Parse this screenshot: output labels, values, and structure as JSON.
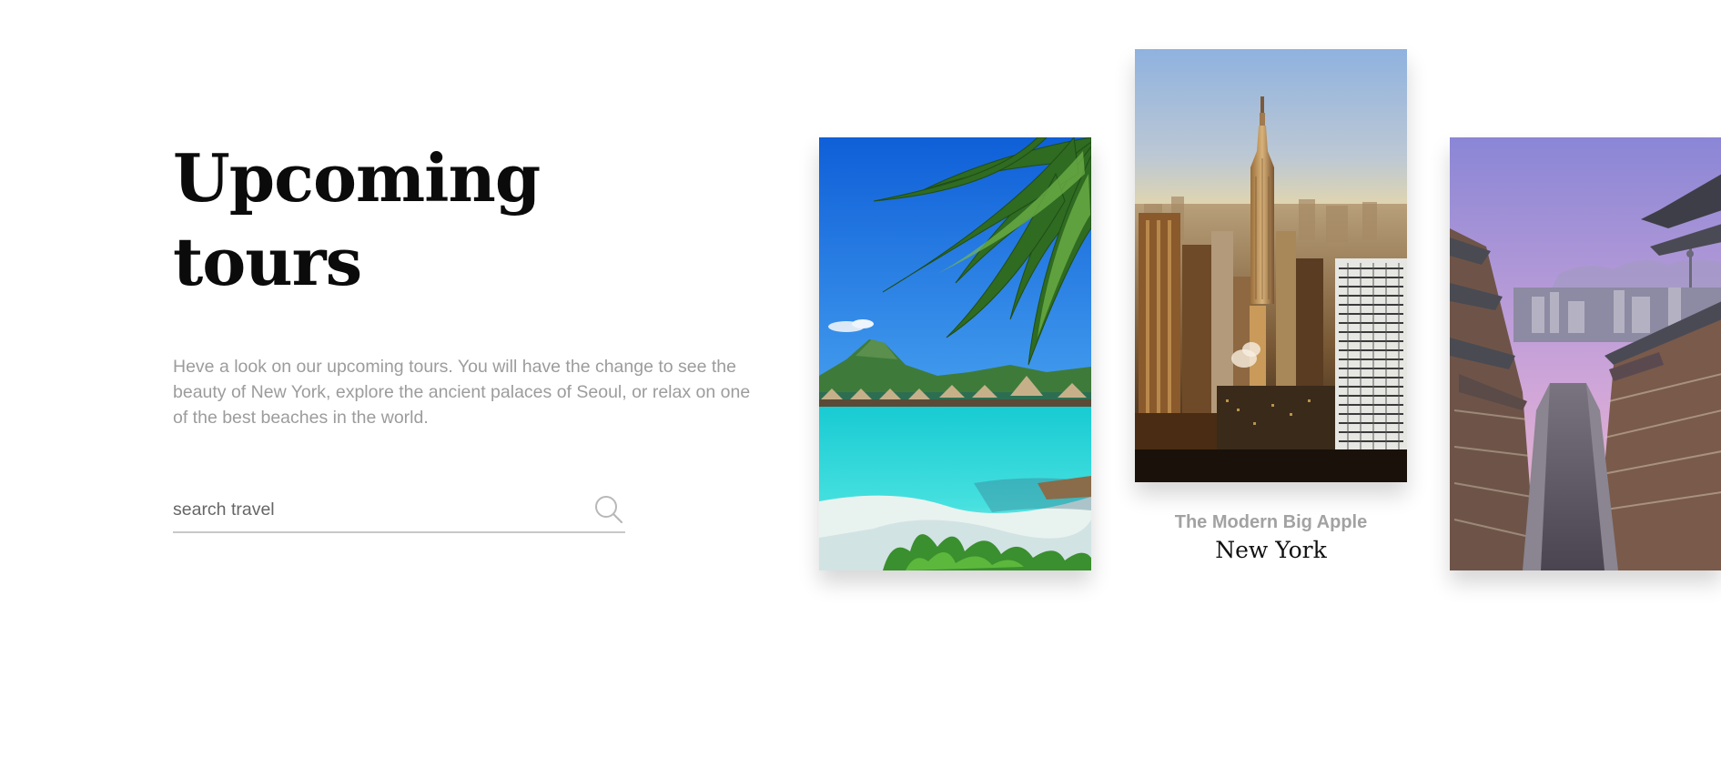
{
  "intro": {
    "title": "Upcoming tours",
    "description": "Heve a look on our upcoming tours. You will have the change to see the beauty of New York, explore the ancient palaces of Seoul, or relax on one of the best beaches in the world."
  },
  "search": {
    "placeholder": "search travel",
    "value": "",
    "icon": "search-icon"
  },
  "tours": [
    {
      "image": "tropical-beach-photo"
    },
    {
      "image": "new-york-skyline-photo",
      "subtitle": "The Modern Big Apple",
      "title": "New York"
    },
    {
      "image": "seoul-hanok-street-photo"
    }
  ],
  "colors": {
    "title": "#0b0b0b",
    "description": "#9c9c9c",
    "subtitle": "#a2a2a2",
    "caption_title": "#111111",
    "underline": "#c8c8c8"
  }
}
